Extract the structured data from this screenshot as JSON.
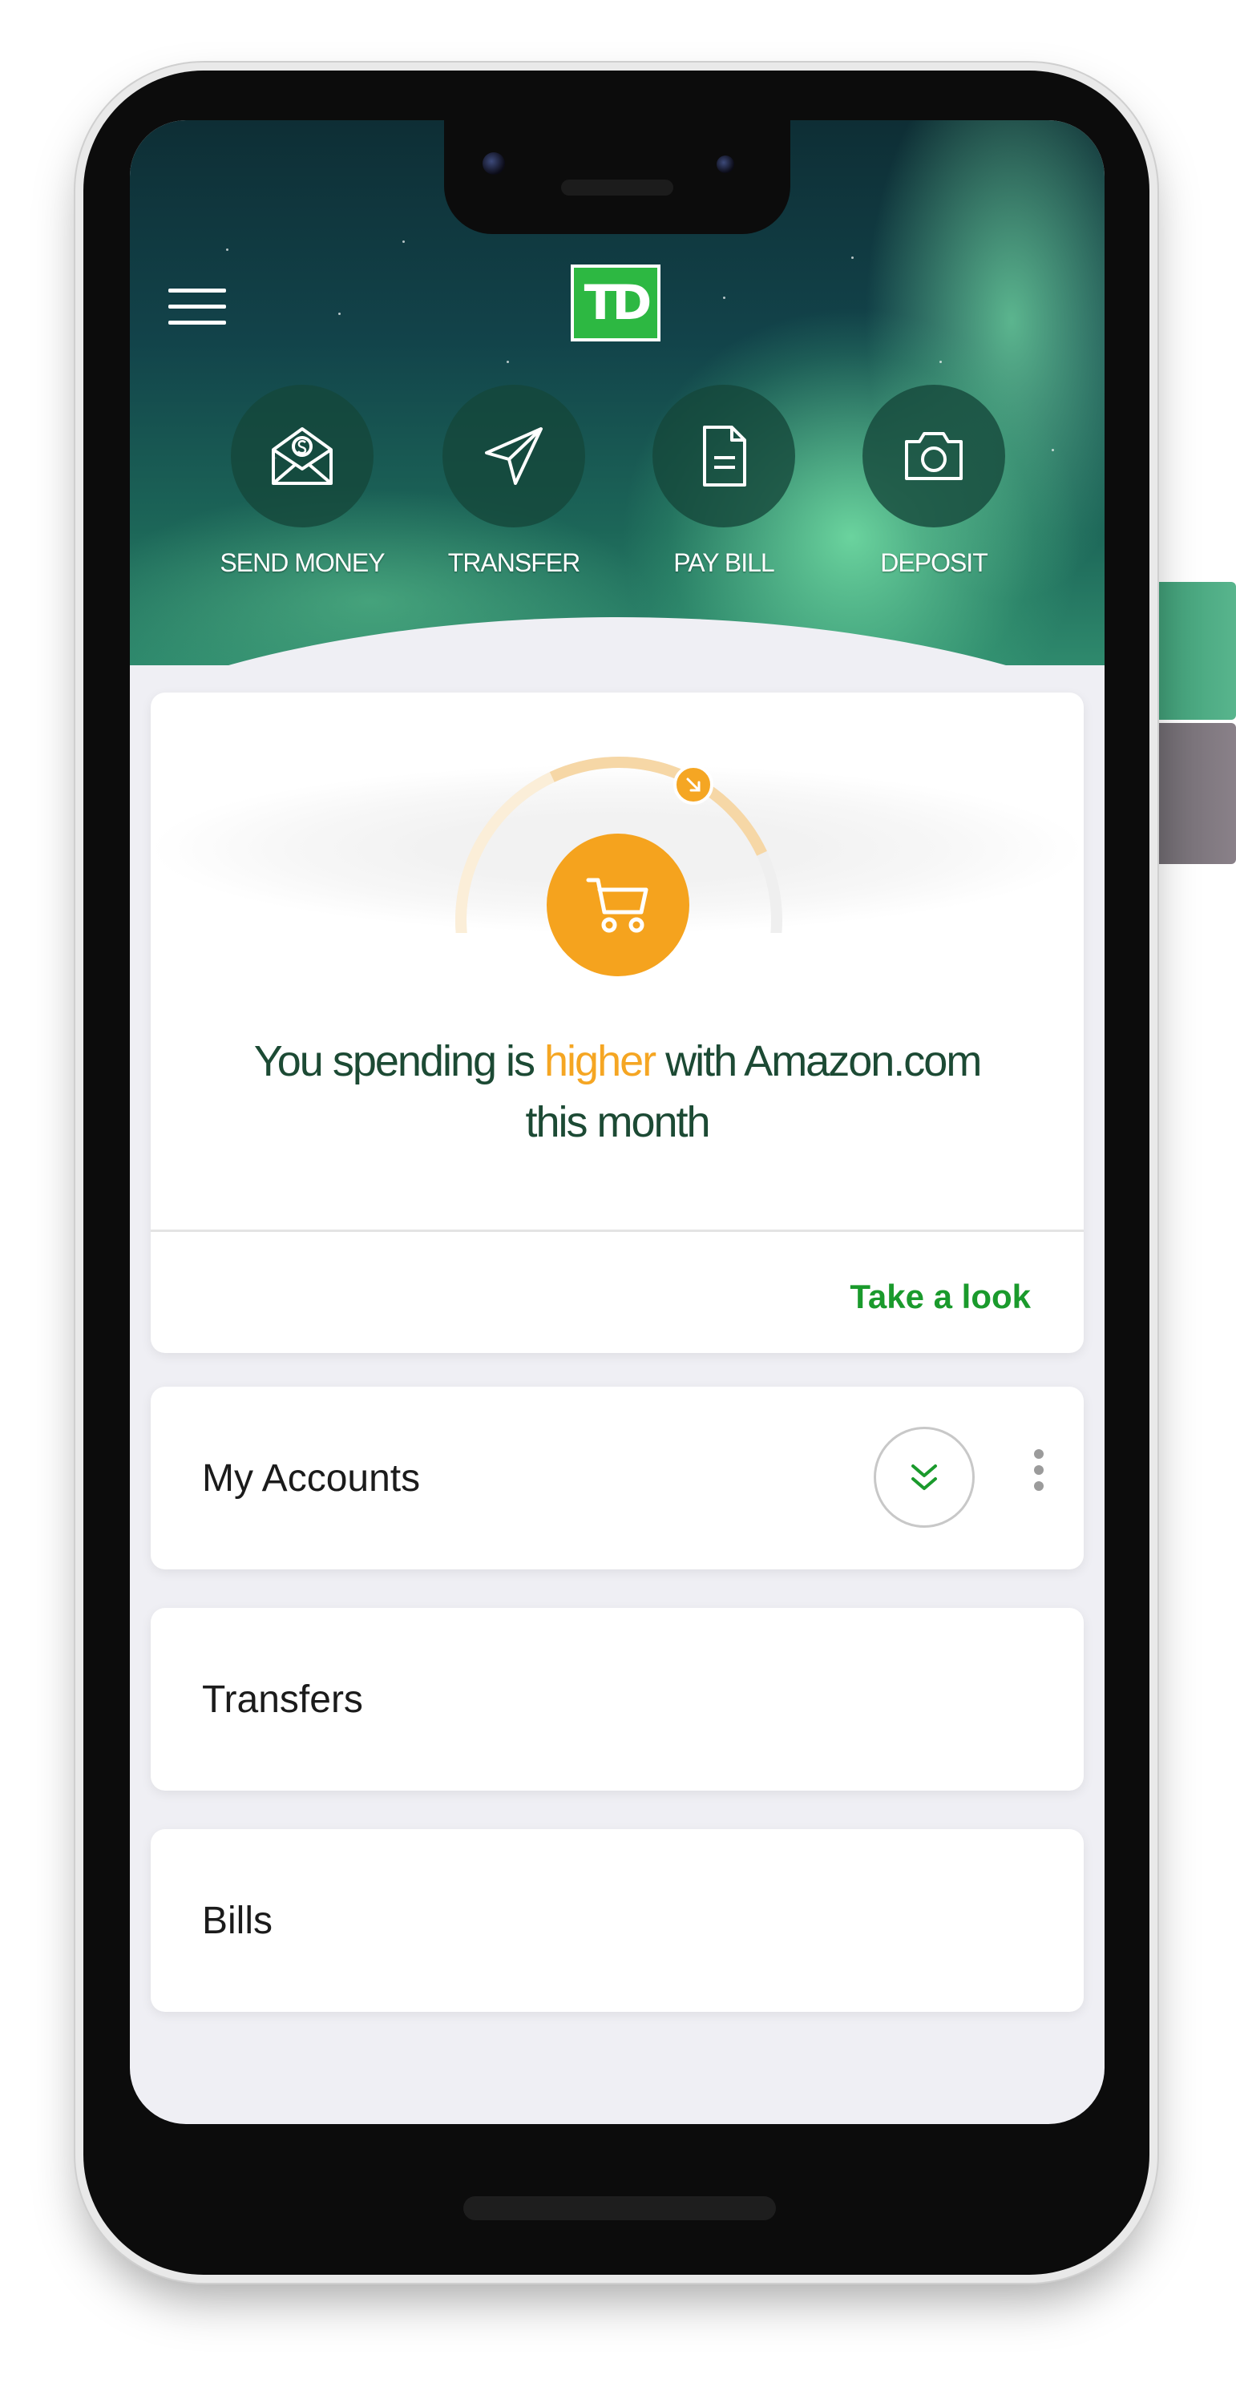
{
  "header": {
    "logo_text": "TD",
    "logo_color": "#2db842",
    "actions": [
      {
        "label": "SEND MONEY",
        "icon": "envelope-dollar-icon"
      },
      {
        "label": "TRANSFER",
        "icon": "paper-plane-icon"
      },
      {
        "label": "PAY BILL",
        "icon": "document-icon"
      },
      {
        "label": "DEPOSIT",
        "icon": "camera-icon"
      }
    ]
  },
  "insight": {
    "text_before": "You spending is ",
    "text_highlight": "higher",
    "text_after": " with Amazon.com",
    "text_line2": "this month",
    "highlight_color": "#f5a623",
    "action_label": "Take a look",
    "action_color": "#1a9a2c",
    "icon": "shopping-cart-icon"
  },
  "sections": {
    "accounts": {
      "label": "My Accounts"
    },
    "transfers": {
      "label": "Transfers"
    },
    "bills": {
      "label": "Bills"
    }
  }
}
